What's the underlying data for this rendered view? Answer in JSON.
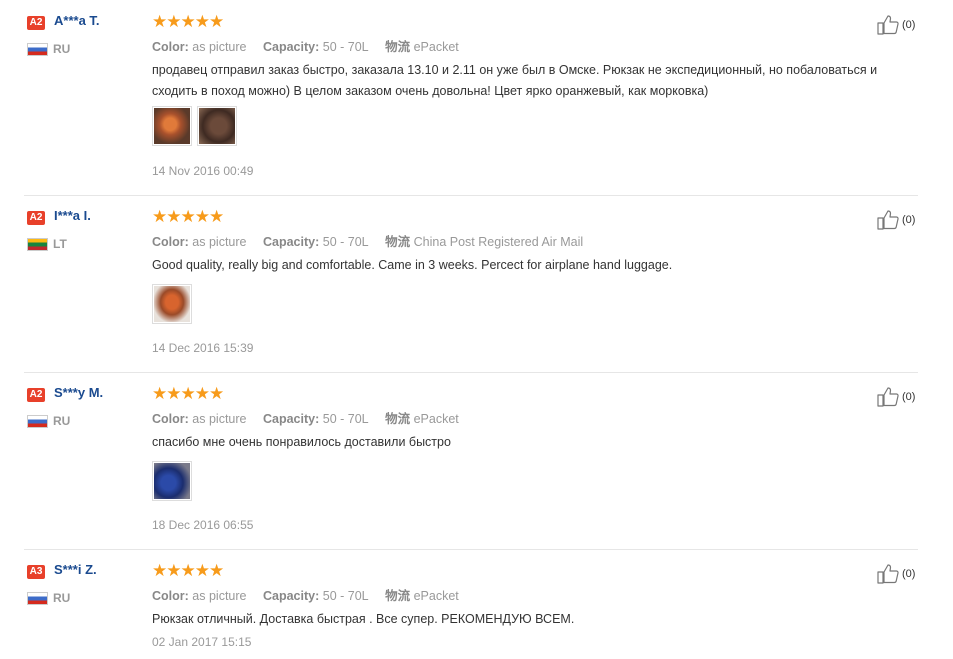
{
  "labels": {
    "color": "Color:",
    "capacity": "Capacity:",
    "shipping": "物流"
  },
  "reviews": [
    {
      "badge": "A2",
      "name": "A***a T.",
      "country": "RU",
      "flag": "ru",
      "color": "as picture",
      "capacity": "50 - 70L",
      "shipping": "ePacket",
      "text": "продавец отправил заказ быстро, заказала 13.10 и 2.11 он уже был в Омске. Рюкзак не экспедиционный, но побаловаться и сходить в поход можно) В целом заказом очень довольна! Цвет ярко оранжевый, как морковка)",
      "photos": [
        "orange backpack photo",
        "backpack photo"
      ],
      "date": "14 Nov 2016 00:49",
      "likes": "(0)",
      "stars": "★★★★★"
    },
    {
      "badge": "A2",
      "name": "I***a I.",
      "country": "LT",
      "flag": "lt",
      "color": "as picture",
      "capacity": "50 - 70L",
      "shipping": "China Post Registered Air Mail",
      "text": "Good quality, really big and comfortable. Came in 3 weeks. Percect for airplane hand luggage.",
      "photos": [
        "orange backpack photo"
      ],
      "date": "14 Dec 2016 15:39",
      "likes": "(0)",
      "stars": "★★★★★"
    },
    {
      "badge": "A2",
      "name": "S***y M.",
      "country": "RU",
      "flag": "ru",
      "color": "as picture",
      "capacity": "50 - 70L",
      "shipping": "ePacket",
      "text": "спасибо мне очень понравилось доставили быстро",
      "photos": [
        "blue backpack photo"
      ],
      "date": "18 Dec 2016 06:55",
      "likes": "(0)",
      "stars": "★★★★★"
    },
    {
      "badge": "A3",
      "name": "S***i Z.",
      "country": "RU",
      "flag": "ru",
      "color": "as picture",
      "capacity": "50 - 70L",
      "shipping": "ePacket",
      "text": "Рюкзак отличный. Доставка быстрая . Все супер. РЕКОМЕНДУЮ ВСЕМ.",
      "photos": [],
      "date": "02 Jan 2017 15:15",
      "likes": "(0)",
      "stars": "★★★★★"
    }
  ]
}
